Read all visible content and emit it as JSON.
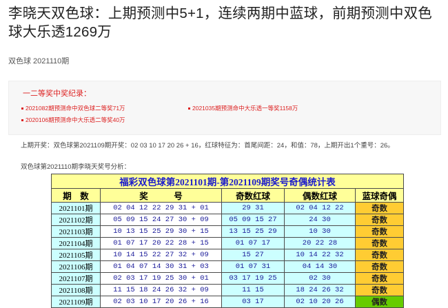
{
  "article": {
    "title": "李晓天双色球：上期预测中5+1，连续两期中蓝球，前期预测中双色球大乐透1269万",
    "subtitle": "双色球 2021110期"
  },
  "awards": {
    "title": "一二等奖中奖纪录：",
    "items": [
      "2021082期预测命中双色球二等奖71万",
      "2021035期预测命中大乐透一等奖1158万",
      "2020106期预测命中大乐透二等奖40万"
    ]
  },
  "info": {
    "last_draw": "上期开奖：双色球第2021109期开奖：02 03 10 17 20 26 + 16，红球特征为：首尾间距：24，和值：78，上期开出1个重号：26。",
    "analysis_intro": "双色球第2021110期李晓天奖号分析："
  },
  "table": {
    "caption": "福彩双色球第2021101期-第2021109期奖号奇偶统计表",
    "headers": [
      "期　数",
      "奖　　　号",
      "奇数红球",
      "偶数红球",
      "蓝球奇偶"
    ],
    "rows": [
      {
        "period": "2021101期",
        "nums": "02 04 12 22 29 31 + 01",
        "odd": "29 31",
        "even": "02 04 12 22",
        "parity": "奇数"
      },
      {
        "period": "2021102期",
        "nums": "05 09 15 24 27 30 + 09",
        "odd": "05 09 15 27",
        "even": "24 30",
        "parity": "奇数"
      },
      {
        "period": "2021103期",
        "nums": "10 13 15 25 29 30 + 15",
        "odd": "13 15 25 29",
        "even": "10 30",
        "parity": "奇数"
      },
      {
        "period": "2021104期",
        "nums": "01 07 17 20 22 28 + 15",
        "odd": "01 07 17",
        "even": "20 22 28",
        "parity": "奇数"
      },
      {
        "period": "2021105期",
        "nums": "10 14 15 22 27 32 + 09",
        "odd": "15 27",
        "even": "10 14 22 32",
        "parity": "奇数"
      },
      {
        "period": "2021106期",
        "nums": "01 04 07 14 30 31 + 03",
        "odd": "01 07 31",
        "even": "04 14 30",
        "parity": "奇数"
      },
      {
        "period": "2021107期",
        "nums": "02 03 17 19 25 30 + 01",
        "odd": "03 17 19 25",
        "even": "02 30",
        "parity": "奇数"
      },
      {
        "period": "2021108期",
        "nums": "11 15 18 24 26 32 + 09",
        "odd": "11 15",
        "even": "18 24 26 32",
        "parity": "奇数"
      },
      {
        "period": "2021109期",
        "nums": "02 03 10 17 20 26 + 16",
        "odd": "03 17",
        "even": "02 10 20 26",
        "parity": "偶数"
      }
    ]
  },
  "colors": {
    "accent_red": "#dd2222",
    "table_header_bg": "#ffff99",
    "cell_cyan": "#ccffff",
    "parity_odd": "#ffcc33",
    "parity_even": "#66cc00"
  }
}
